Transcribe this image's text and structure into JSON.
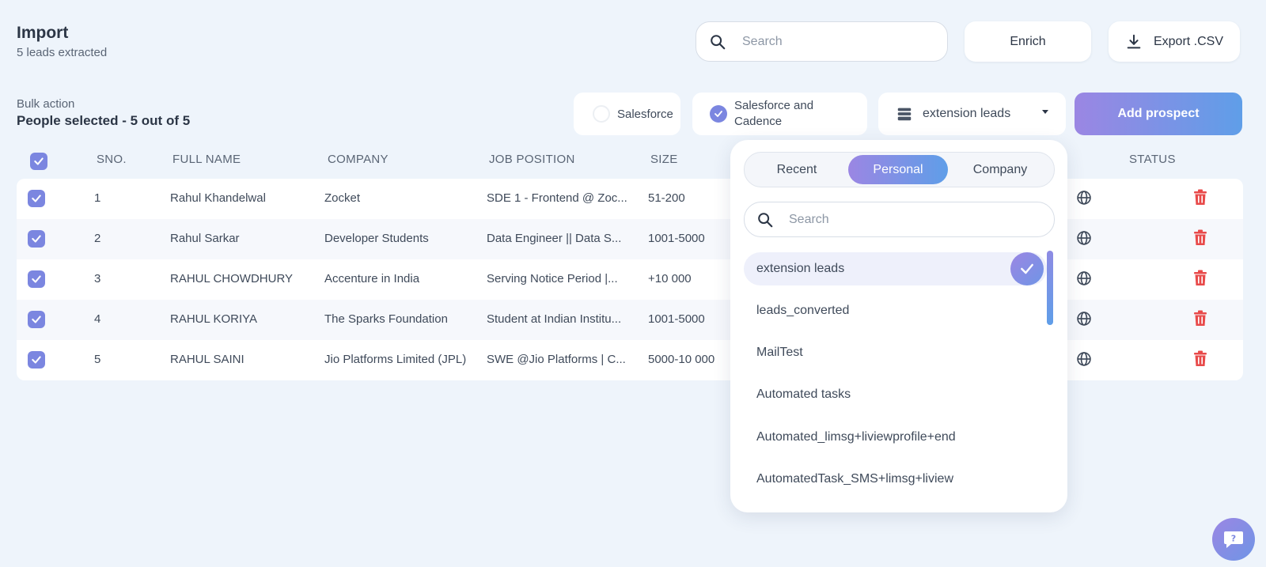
{
  "header": {
    "title": "Import",
    "subtitle": "5 leads extracted",
    "search_placeholder": "Search",
    "enrich_label": "Enrich",
    "export_label": "Export .CSV"
  },
  "bulk": {
    "label": "Bulk action",
    "selected_text": "People selected - 5 out of 5"
  },
  "sync_options": {
    "salesforce": "Salesforce",
    "salesforce_cadence_line1": "Salesforce and",
    "salesforce_cadence_line2": "Cadence"
  },
  "list_select": {
    "value": "extension leads"
  },
  "add_prospect_label": "Add prospect",
  "table": {
    "columns": [
      "SNO.",
      "FULL NAME",
      "COMPANY",
      "JOB POSITION",
      "SIZE",
      "STATUS"
    ],
    "rows": [
      {
        "sno": "1",
        "name": "Rahul Khandelwal",
        "company": "Zocket",
        "position": "SDE 1 - Frontend @ Zoc...",
        "size": "51-200"
      },
      {
        "sno": "2",
        "name": "Rahul Sarkar",
        "company": "Developer Students",
        "position": "Data Engineer || Data S...",
        "size": "1001-5000"
      },
      {
        "sno": "3",
        "name": "RAHUL CHOWDHURY",
        "company": "Accenture in India",
        "position": "Serving Notice Period |...",
        "size": "+10 000"
      },
      {
        "sno": "4",
        "name": "RAHUL KORIYA",
        "company": "The Sparks Foundation",
        "position": "Student at Indian Institu...",
        "size": "1001-5000"
      },
      {
        "sno": "5",
        "name": "RAHUL SAINI",
        "company": "Jio Platforms Limited (JPL)",
        "position": "SWE @Jio Platforms | C...",
        "size": "5000-10 000"
      }
    ]
  },
  "dropdown": {
    "tabs": [
      "Recent",
      "Personal",
      "Company"
    ],
    "active_tab": "Personal",
    "search_placeholder": "Search",
    "items": [
      "extension leads",
      "leads_converted",
      "MailTest",
      "Automated tasks",
      "Automated_limsg+liviewprofile+end",
      "AutomatedTask_SMS+limsg+liview"
    ],
    "selected_item": "extension leads"
  },
  "icons": {
    "search": "search-icon",
    "export": "download-icon",
    "list": "database-icon",
    "globe": "globe-icon",
    "trash": "trash-icon",
    "help": "chat-help-icon"
  },
  "colors": {
    "accent": "#7b86e0",
    "gradient_start": "#9b86e3",
    "gradient_end": "#5f9ee8",
    "delete": "#e84a4a",
    "background": "#eef4fb"
  }
}
